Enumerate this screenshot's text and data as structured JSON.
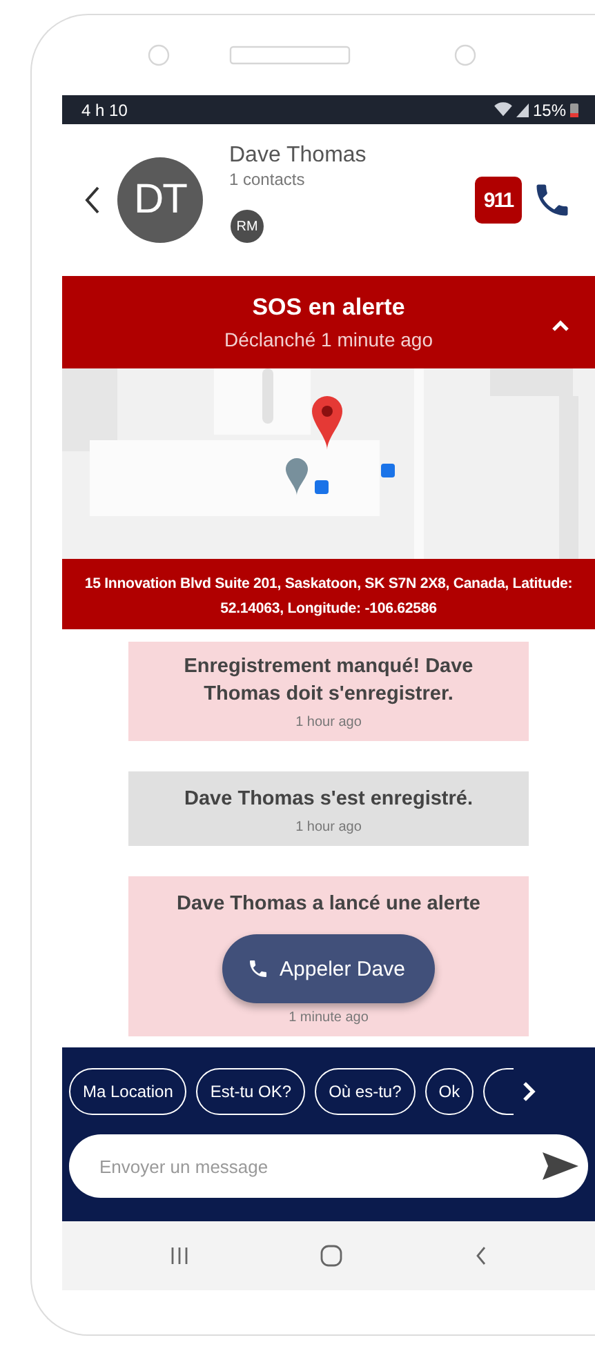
{
  "status_bar": {
    "time": "4 h 10",
    "battery": "15%"
  },
  "header": {
    "avatar_initials": "DT",
    "name": "Dave Thomas",
    "subtitle": "1 contacts",
    "member_badge": "RM",
    "emergency_button": "911"
  },
  "alert": {
    "title": "SOS en alerte",
    "subtitle": "Déclanché 1 minute ago",
    "expanded": true
  },
  "address": "15 Innovation Blvd Suite 201, Saskatoon, SK S7N 2X8, Canada, Latitude: 52.14063, Longitude: -106.62586",
  "messages": [
    {
      "kind": "missed",
      "text": "Enregistrement manqué! Dave Thomas doit s'enregistrer.",
      "time": "1 hour ago"
    },
    {
      "kind": "checkin",
      "text": "Dave Thomas s'est enregistré.",
      "time": "1 hour ago"
    },
    {
      "kind": "alert",
      "text": "Dave Thomas a lancé une alerte",
      "action": "Appeler Dave",
      "time": "1 minute ago"
    }
  ],
  "quick_replies": [
    "Ma Location",
    "Est-tu OK?",
    "Où es-tu?",
    "Ok"
  ],
  "composer": {
    "placeholder": "Envoyer un message"
  }
}
